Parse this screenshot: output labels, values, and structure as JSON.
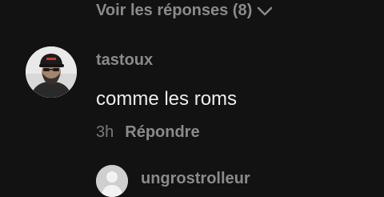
{
  "thread": {
    "view_replies_label": "Voir les réponses (8)",
    "chevron_icon": "chevron-down-icon"
  },
  "comment": {
    "username": "tastoux",
    "text": "comme les roms",
    "time": "3h",
    "reply_label": "Répondre",
    "avatar_icon": "user-avatar"
  },
  "reply_preview": {
    "username": "ungrostrolleur",
    "avatar_icon": "default-avatar-icon"
  },
  "colors": {
    "background": "#121212",
    "muted_text": "#8a8a8a",
    "primary_text": "#ececec"
  }
}
